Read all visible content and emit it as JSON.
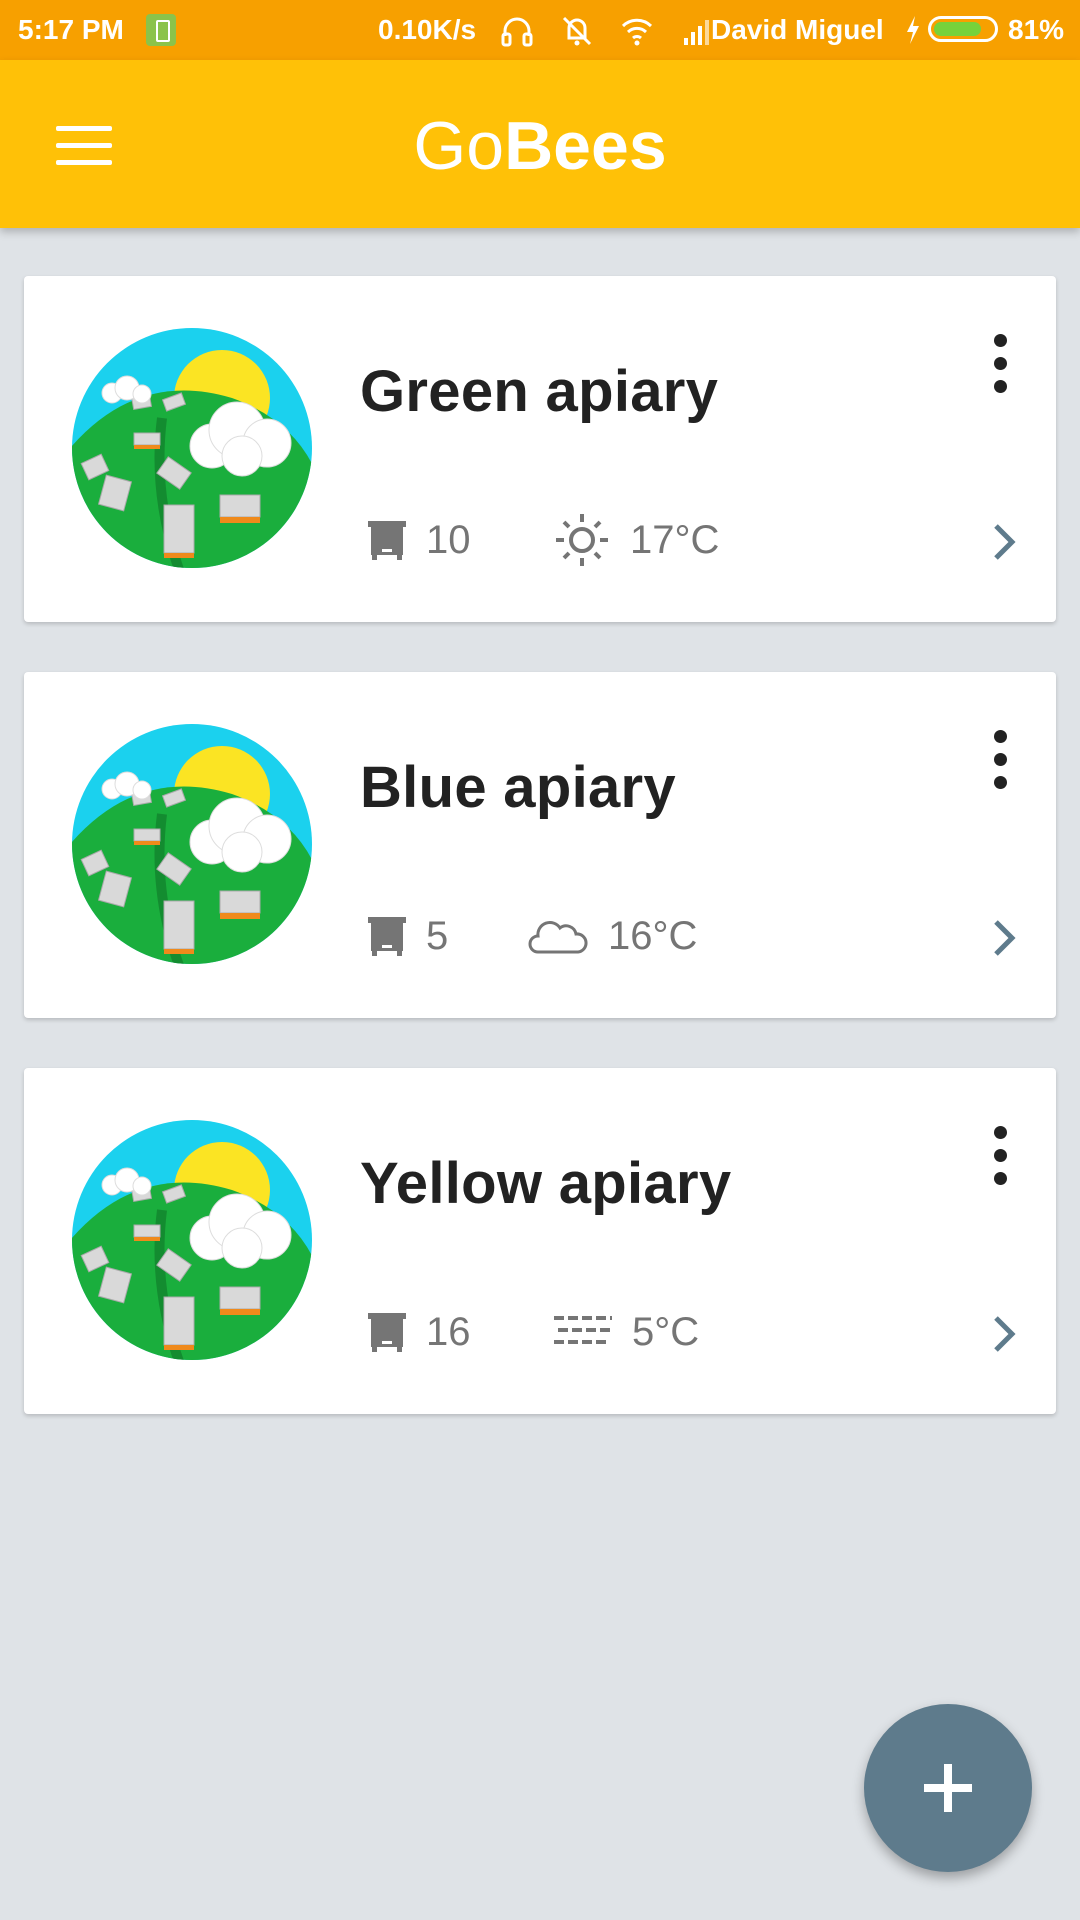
{
  "status_bar": {
    "time": "5:17 PM",
    "speed": "0.10K/s",
    "carrier": "David Miguel",
    "battery_percent": "81%",
    "battery_level": 0.81
  },
  "app_bar": {
    "title_part1": "Go",
    "title_part2": "Bees",
    "menu_icon": "hamburger-menu-icon"
  },
  "apiaries": [
    {
      "name": "Green apiary",
      "hives": "10",
      "weather_icon": "sun-icon",
      "temperature": "17°C"
    },
    {
      "name": "Blue apiary",
      "hives": "5",
      "weather_icon": "cloud-icon",
      "temperature": "16°C"
    },
    {
      "name": "Yellow apiary",
      "hives": "16",
      "weather_icon": "fog-icon",
      "temperature": "5°C"
    }
  ],
  "fab": {
    "icon": "plus-icon"
  },
  "colors": {
    "status_bar": "#f7a000",
    "app_bar": "#ffc107",
    "background": "#dfe3e7",
    "fab": "#5e7b8c",
    "chevron": "#5e7b8c"
  }
}
